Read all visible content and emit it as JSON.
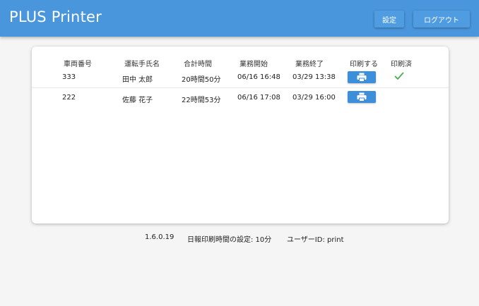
{
  "header": {
    "title": "PLUS Printer",
    "settings_label": "設定",
    "logout_label": "ログアウト",
    "bar_color": "#4a96dc"
  },
  "table": {
    "columns": [
      "車両番号",
      "運転手氏名",
      "合計時間",
      "業務開始",
      "業務終了",
      "印刷する",
      "印刷済"
    ],
    "rows": [
      {
        "vehicle_no": "333",
        "driver": "田中 太郎",
        "total_time": "20時間50分",
        "start": "06/16 16:48",
        "end": "03/29 13:38",
        "print_icon": "printer-icon",
        "printed": true,
        "printed_icon": "check-icon"
      },
      {
        "vehicle_no": "222",
        "driver": "佐藤 花子",
        "total_time": "22時間53分",
        "start": "06/16 17:08",
        "end": "03/29 16:00",
        "print_icon": "printer-icon",
        "printed": false
      }
    ],
    "accent_color": "#3d8fd9",
    "check_color": "#4caf50"
  },
  "footer": {
    "version": "1.6.0.19",
    "print_time_setting": "日報印刷時間の設定: 10分",
    "user_id": "ユーザーID: print"
  }
}
